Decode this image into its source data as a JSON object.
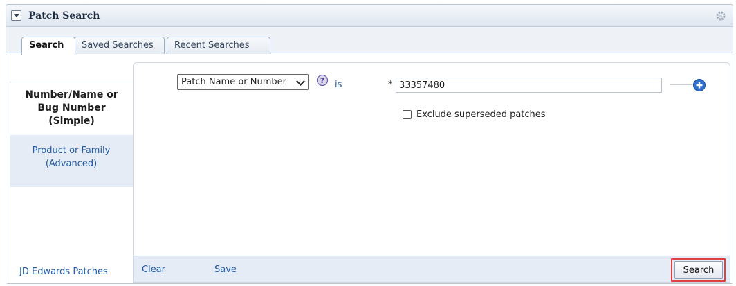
{
  "header": {
    "title": "Patch Search"
  },
  "tabs": [
    {
      "label": "Search",
      "active": true
    },
    {
      "label": "Saved Searches",
      "active": false
    },
    {
      "label": "Recent Searches",
      "active": false
    }
  ],
  "side_nav": {
    "items": [
      {
        "label": "Number/Name or Bug Number (Simple)",
        "lines": [
          "Number/Name or",
          "Bug Number",
          "(Simple)"
        ],
        "active": true
      },
      {
        "label": "Product or Family (Advanced)",
        "lines": [
          "Product or Family",
          "(Advanced)"
        ],
        "active": false
      }
    ],
    "bottom_link": "JD Edwards Patches"
  },
  "search_form": {
    "field_select": "Patch Name or Number",
    "operator": "is",
    "required_marker": "*",
    "value": "33357480",
    "exclude_superseded_label": "Exclude superseded patches",
    "exclude_superseded_checked": false
  },
  "footer": {
    "clear_label": "Clear",
    "save_label": "Save",
    "search_label": "Search"
  },
  "colors": {
    "link": "#1f5aa6",
    "highlight": "#e04040",
    "panel_border": "#b7c4d4"
  }
}
